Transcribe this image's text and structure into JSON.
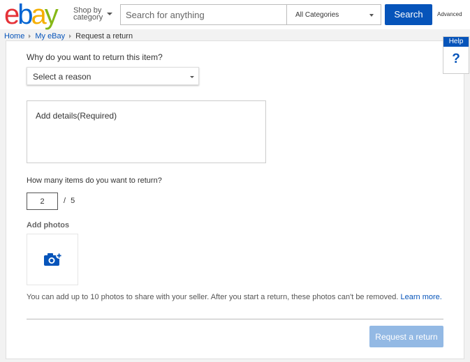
{
  "header": {
    "logo_letters": [
      "e",
      "b",
      "a",
      "y"
    ],
    "logo_colors": [
      "#e53238",
      "#0064d2",
      "#f5af02",
      "#86b817"
    ],
    "shop_by_line1": "Shop by",
    "shop_by_line2": "category",
    "search_placeholder": "Search for anything",
    "category_selected": "All Categories",
    "search_button": "Search",
    "advanced_link": "Advanced",
    "accent_color": "#0654ba"
  },
  "breadcrumb": {
    "items": [
      "Home",
      "My eBay",
      "Request a return"
    ]
  },
  "form": {
    "reason_question": "Why do you want to return this item?",
    "reason_select": "Select a reason",
    "details_placeholder": "Add details(Required)",
    "items_question": "How many items do you want to return?",
    "quantity_value": "2",
    "quantity_separator": "/",
    "quantity_max": "5",
    "photos_label": "Add photos",
    "photo_icon": "camera-add-icon",
    "photo_note": "You can add up to 10 photos to share with your seller. After you start a return, these photos can't be removed.",
    "learn_more": "Learn more.",
    "submit_button": "Request a return"
  },
  "help": {
    "label": "Help",
    "icon_text": "?"
  }
}
